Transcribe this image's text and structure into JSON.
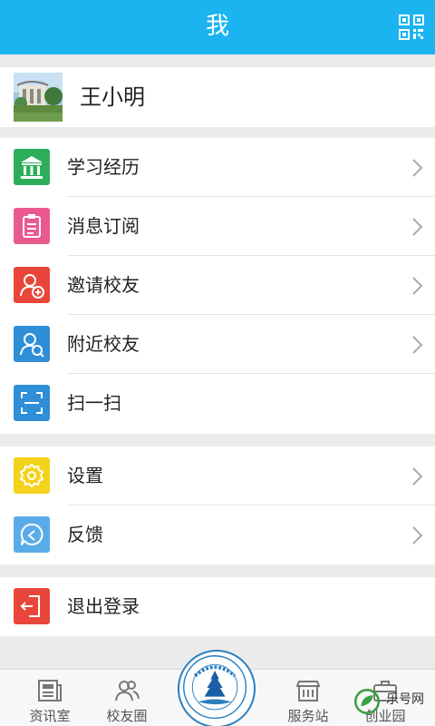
{
  "header": {
    "title": "我",
    "qr_icon": "qr-code-icon"
  },
  "profile": {
    "name": "王小明"
  },
  "menu_group1": [
    {
      "label": "学习经历",
      "icon": "bank-icon",
      "color": "#2cae58"
    },
    {
      "label": "消息订阅",
      "icon": "clipboard-icon",
      "color": "#ea5a8f"
    },
    {
      "label": "邀请校友",
      "icon": "add-user-icon",
      "color": "#e8463b"
    },
    {
      "label": "附近校友",
      "icon": "search-user-icon",
      "color": "#2f8ed8"
    },
    {
      "label": "扫一扫",
      "icon": "scan-icon",
      "color": "#2f8ed8"
    }
  ],
  "menu_group2": [
    {
      "label": "设置",
      "icon": "gear-icon",
      "color": "#f3d21c"
    },
    {
      "label": "反馈",
      "icon": "feedback-icon",
      "color": "#5aace8"
    }
  ],
  "logout": {
    "label": "退出登录",
    "icon": "exit-icon",
    "color": "#e8463b"
  },
  "tabs": [
    {
      "label": "资讯室",
      "icon": "newspaper-icon"
    },
    {
      "label": "校友圈",
      "icon": "friends-icon"
    },
    {
      "label": "服务站",
      "icon": "shop-icon"
    },
    {
      "label": "创业园",
      "icon": "briefcase-icon"
    }
  ],
  "watermark": {
    "text": "乐号网"
  }
}
